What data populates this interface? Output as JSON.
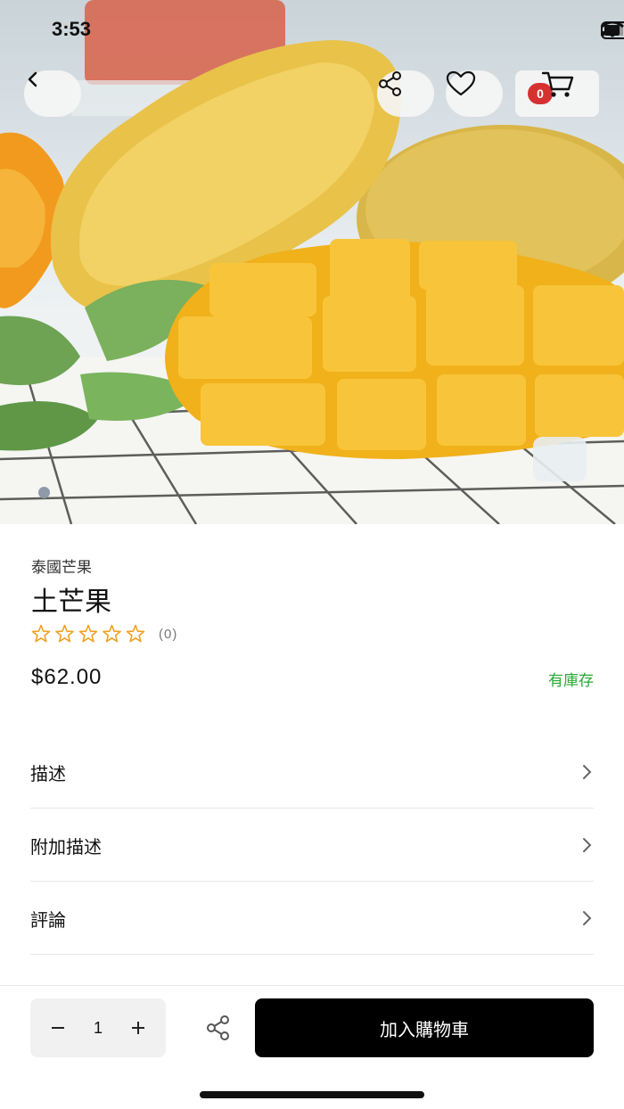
{
  "status_bar": {
    "time": "3:53"
  },
  "header": {
    "cart_count": "0"
  },
  "gallery": {
    "image_subject": "mangoes"
  },
  "product": {
    "category": "泰國芒果",
    "name": "土芒果",
    "rating_count": "(0)",
    "rating_stars": 0,
    "price": "$62.00",
    "stock_status": "有庫存"
  },
  "sections": [
    {
      "label": "描述"
    },
    {
      "label": "附加描述"
    },
    {
      "label": "評論"
    }
  ],
  "bottom_bar": {
    "quantity": "1",
    "add_to_cart_label": "加入購物車"
  },
  "colors": {
    "accent_star": "#f0a020",
    "stock_green": "#2aa836",
    "badge_red": "#d63131",
    "primary_button": "#000000"
  },
  "icons": [
    "back-icon",
    "share-icon",
    "heart-icon",
    "cart-icon",
    "chevron-right-icon",
    "minus-icon",
    "plus-icon"
  ]
}
